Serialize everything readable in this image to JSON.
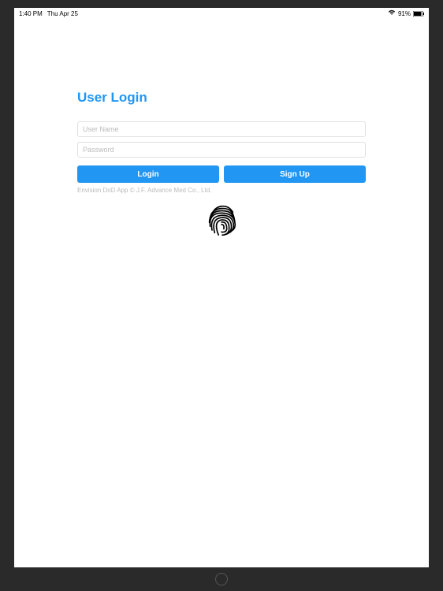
{
  "statusBar": {
    "time": "1:40 PM",
    "date": "Thu Apr 25",
    "batteryPercent": "91%"
  },
  "page": {
    "title": "User Login"
  },
  "form": {
    "usernamePlaceholder": "User Name",
    "passwordPlaceholder": "Password"
  },
  "buttons": {
    "login": "Login",
    "signup": "Sign Up"
  },
  "footer": {
    "copyright": "Envision DoD App © J.F. Advance Med Co., Ltd."
  }
}
